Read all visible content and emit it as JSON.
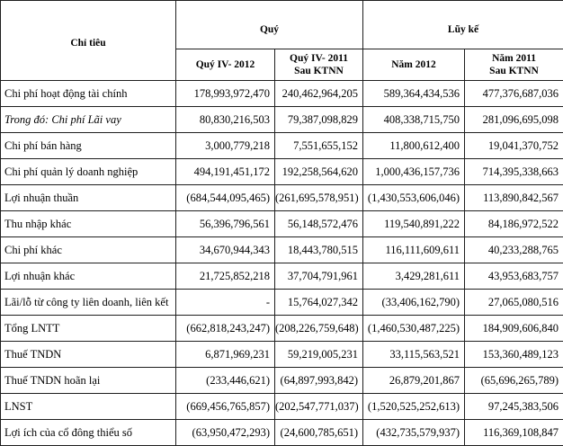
{
  "header": {
    "indicator": "Chỉ tiêu",
    "quarter_group": "Quý",
    "cumulative_group": "Lũy kế",
    "columns": [
      {
        "line1": "Quý IV- 2012",
        "line2": ""
      },
      {
        "line1": "Quý IV- 2011",
        "line2": "Sau KTNN"
      },
      {
        "line1": "Năm 2012",
        "line2": ""
      },
      {
        "line1": "Năm 2011",
        "line2": "Sau KTNN"
      }
    ]
  },
  "rows": [
    {
      "label": "Chi phí hoạt động tài chính",
      "italic": false,
      "values": [
        "178,993,972,470",
        "240,462,964,205",
        "589,364,434,536",
        "477,376,687,036"
      ]
    },
    {
      "label": "Trong đó: Chi phí Lãi vay",
      "italic": true,
      "values": [
        "80,830,216,503",
        "79,387,098,829",
        "408,338,715,750",
        "281,096,695,098"
      ]
    },
    {
      "label": "Chi phí bán hàng",
      "italic": false,
      "values": [
        "3,000,779,218",
        "7,551,655,152",
        "11,800,612,400",
        "19,041,370,752"
      ]
    },
    {
      "label": "Chi phí quản lý doanh nghiệp",
      "italic": false,
      "values": [
        "494,191,451,172",
        "192,258,564,620",
        "1,000,436,157,736",
        "714,395,338,663"
      ]
    },
    {
      "label": "Lợi nhuận thuần",
      "italic": false,
      "values": [
        "(684,544,095,465)",
        "(261,695,578,951)",
        "(1,430,553,606,046)",
        "113,890,842,567"
      ]
    },
    {
      "label": "Thu nhập khác",
      "italic": false,
      "values": [
        "56,396,796,561",
        "56,148,572,476",
        "119,540,891,222",
        "84,186,972,522"
      ]
    },
    {
      "label": "Chi phí khác",
      "italic": false,
      "values": [
        "34,670,944,343",
        "18,443,780,515",
        "116,111,609,611",
        "40,233,288,765"
      ]
    },
    {
      "label": "Lợi nhuận khác",
      "italic": false,
      "values": [
        "21,725,852,218",
        "37,704,791,961",
        "3,429,281,611",
        "43,953,683,757"
      ]
    },
    {
      "label": "Lãi/lỗ từ công ty liên doanh, liên kết",
      "italic": false,
      "values": [
        "-",
        "15,764,027,342",
        "(33,406,162,790)",
        "27,065,080,516"
      ]
    },
    {
      "label": "Tổng LNTT",
      "italic": false,
      "values": [
        "(662,818,243,247)",
        "(208,226,759,648)",
        "(1,460,530,487,225)",
        "184,909,606,840"
      ]
    },
    {
      "label": "Thuế TNDN",
      "italic": false,
      "values": [
        "6,871,969,231",
        "59,219,005,231",
        "33,115,563,521",
        "153,360,489,123"
      ]
    },
    {
      "label": "Thuế TNDN hoãn lại",
      "italic": false,
      "values": [
        "(233,446,621)",
        "(64,897,993,842)",
        "26,879,201,867",
        "(65,696,265,789)"
      ]
    },
    {
      "label": "LNST",
      "italic": false,
      "values": [
        "(669,456,765,857)",
        "(202,547,771,037)",
        "(1,520,525,252,613)",
        "97,245,383,506"
      ]
    },
    {
      "label": "Lợi ích của cổ đông thiểu số",
      "italic": false,
      "values": [
        "(63,950,472,293)",
        "(24,600,785,651)",
        "(432,735,579,937)",
        "116,369,108,847"
      ]
    }
  ]
}
